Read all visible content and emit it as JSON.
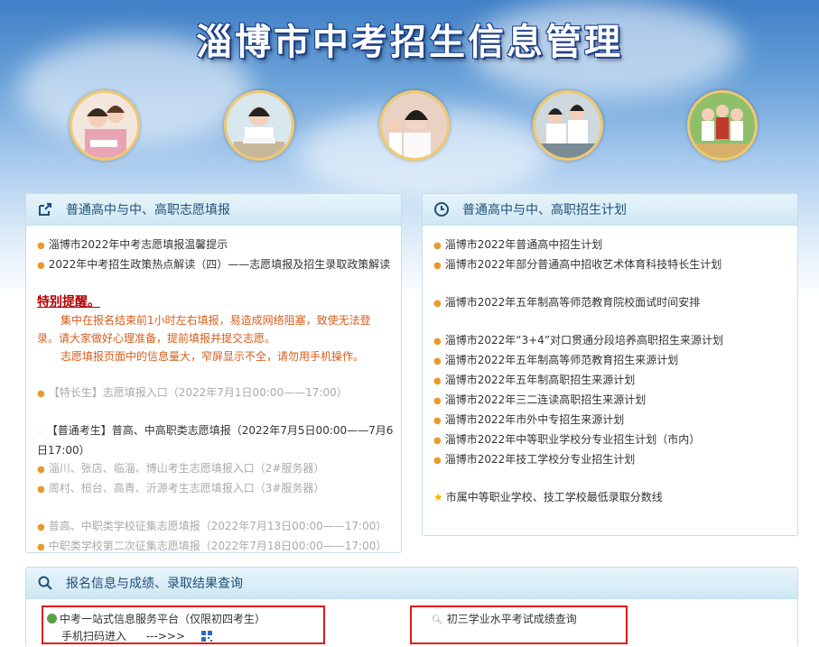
{
  "header": {
    "title": "淄博市中考招生信息管理"
  },
  "left_panel": {
    "title": "普通高中与中、高职志愿填报",
    "links": [
      "淄博市2022年中考志愿填报温馨提示",
      "2022年中考招生政策热点解读（四）——志愿填报及招生录取政策解读"
    ],
    "notice_title": "特别提醒。",
    "notice_lines": [
      "集中在报名结束前1小时左右填报，易造成网络阻塞，致使无法登",
      "录。请大家做好心理准备，提前填报并提交志愿。",
      "志愿填报页面中的信息量大，窄屏显示不全，请勿用手机操作。"
    ],
    "special_entry": "【特长生】志愿填报入口（2022年7月1日00:00——17:00）",
    "normal_title_1": "【普通考生】普高、中高职类志愿填报（2022年7月5日00:00——7月6",
    "normal_title_2": "日17:00）",
    "entry_1": "淄川、张店、临淄、博山考生志愿填报入口（2#服务器）",
    "entry_2": "周村、桓台、高青、沂源考生志愿填报入口（3#服务器）",
    "collect_1": "普高、中职类学校征集志愿填报（2022年7月13日00:00——17:00）",
    "collect_2": "中职类学校第二次征集志愿填报（2022年7月18日00:00——17:00）"
  },
  "right_panel": {
    "title": "普通高中与中、高职招生计划",
    "links_a": [
      "淄博市2022年普通高中招生计划",
      "淄博市2022年部分普通高中招收艺术体育科技特长生计划"
    ],
    "links_b": [
      "淄博市2022年五年制高等师范教育院校面试时间安排"
    ],
    "links_c": [
      "淄博市2022年“3+4”对口贯通分段培养高职招生来源计划",
      "淄博市2022年五年制高等师范教育招生来源计划",
      "淄博市2022年五年制高职招生来源计划",
      "淄博市2022年三二连读高职招生来源计划",
      "淄博市2022年市外中专招生来源计划",
      "淄博市2022年中等职业学校分专业招生计划（市内）",
      "淄博市2022年技工学校分专业招生计划"
    ],
    "star_link": "市属中等职业学校、技工学校最低录取分数线"
  },
  "bottom_panel": {
    "title": "报名信息与成绩、录取结果查询",
    "platform_link": "中考一站式信息服务平台（仅限初四考生）",
    "mobile_text": "手机扫码进入",
    "arrow_text": "--->>>",
    "score_link": "初三学业水平考试成绩查询"
  },
  "colors": {
    "accent": "#1f4f79",
    "warning": "#d55d1a",
    "highlight_box": "#e11a1a"
  }
}
